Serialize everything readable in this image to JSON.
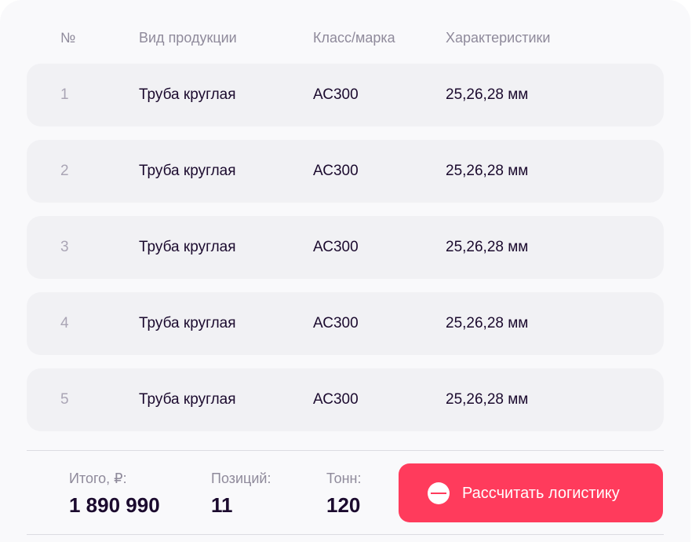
{
  "table": {
    "headers": {
      "num": "№",
      "product": "Вид продукции",
      "grade": "Класс/марка",
      "specs": "Характеристики"
    },
    "rows": [
      {
        "num": "1",
        "product": "Труба круглая",
        "grade": "АС300",
        "specs": "25,26,28 мм"
      },
      {
        "num": "2",
        "product": "Труба круглая",
        "grade": "АС300",
        "specs": "25,26,28 мм"
      },
      {
        "num": "3",
        "product": "Труба круглая",
        "grade": "АС300",
        "specs": "25,26,28 мм"
      },
      {
        "num": "4",
        "product": "Труба круглая",
        "grade": "АС300",
        "specs": "25,26,28 мм"
      },
      {
        "num": "5",
        "product": "Труба круглая",
        "grade": "АС300",
        "specs": "25,26,28 мм"
      }
    ]
  },
  "summary": {
    "total_label": "Итого, ₽:",
    "total_value": "1 890 990",
    "positions_label": "Позиций:",
    "positions_value": "11",
    "tons_label": "Тонн:",
    "tons_value": "120"
  },
  "actions": {
    "calculate_label": "Рассчитать логистику",
    "calculate_icon": "equals-circle-icon"
  },
  "colors": {
    "accent": "#ff3b5c",
    "text": "#1b0a2e",
    "muted": "#8f8a9b",
    "row_bg": "#f1f1f4"
  }
}
